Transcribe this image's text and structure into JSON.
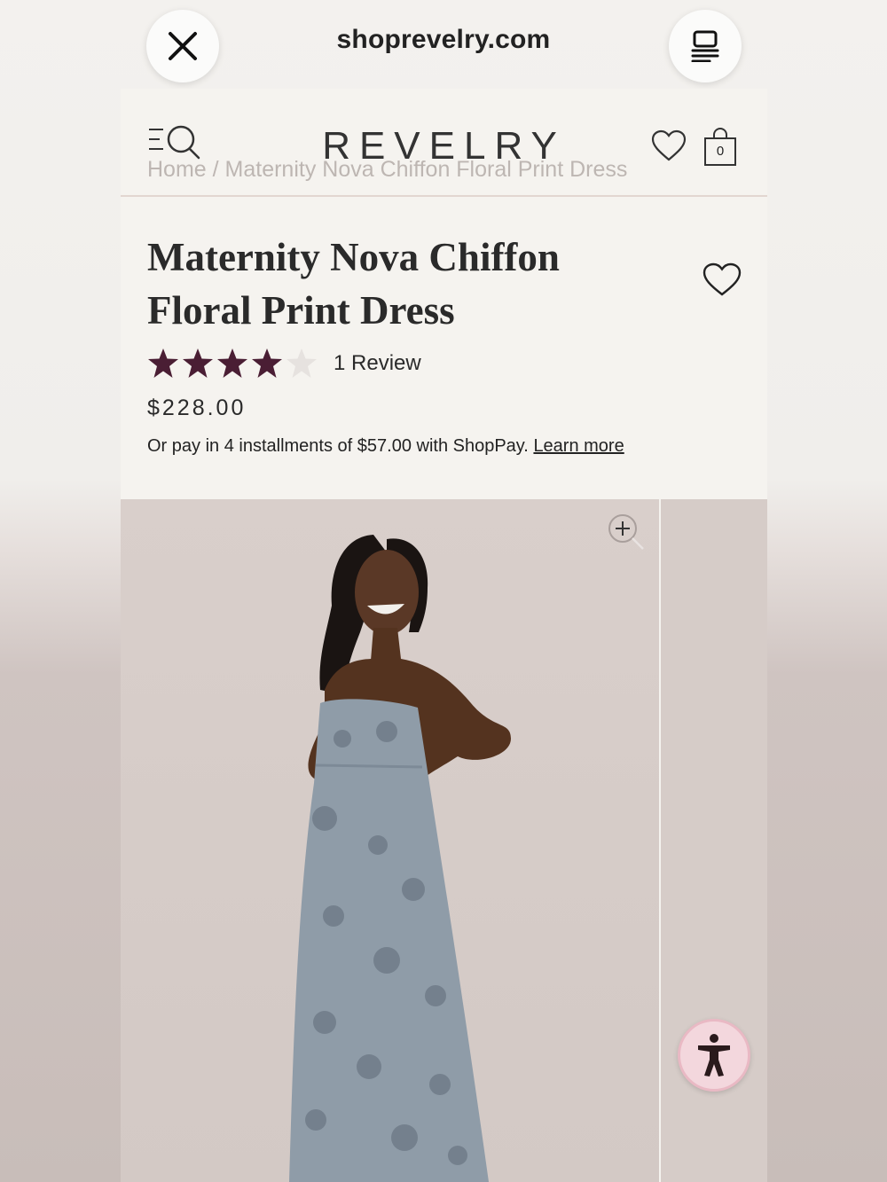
{
  "browser": {
    "url": "shoprevelry.com",
    "close_icon": "close-icon",
    "tabs_icon": "tabs-icon"
  },
  "header": {
    "logo": "REVELRY",
    "menu_icon": "menu-icon",
    "search_icon": "search-icon",
    "wishlist_icon": "heart-icon",
    "cart_icon": "shopping-bag-icon",
    "cart_count": "0"
  },
  "breadcrumb": "Home / Maternity Nova Chiffon Floral Print Dress",
  "product": {
    "title": "Maternity Nova Chiffon Floral Print Dress",
    "rating": 4,
    "rating_max": 5,
    "review_count": "1 Review",
    "price": "$228.00",
    "installments_text": "Or pay in 4 installments of $57.00 with ShopPay.",
    "learn_more": "Learn more"
  },
  "gallery": {
    "zoom_icon": "zoom-in-icon",
    "accessibility_icon": "accessibility-icon"
  },
  "colors": {
    "star_filled": "#4a1e34",
    "star_empty": "#e6e2df",
    "dress": "#8f9ca8"
  }
}
